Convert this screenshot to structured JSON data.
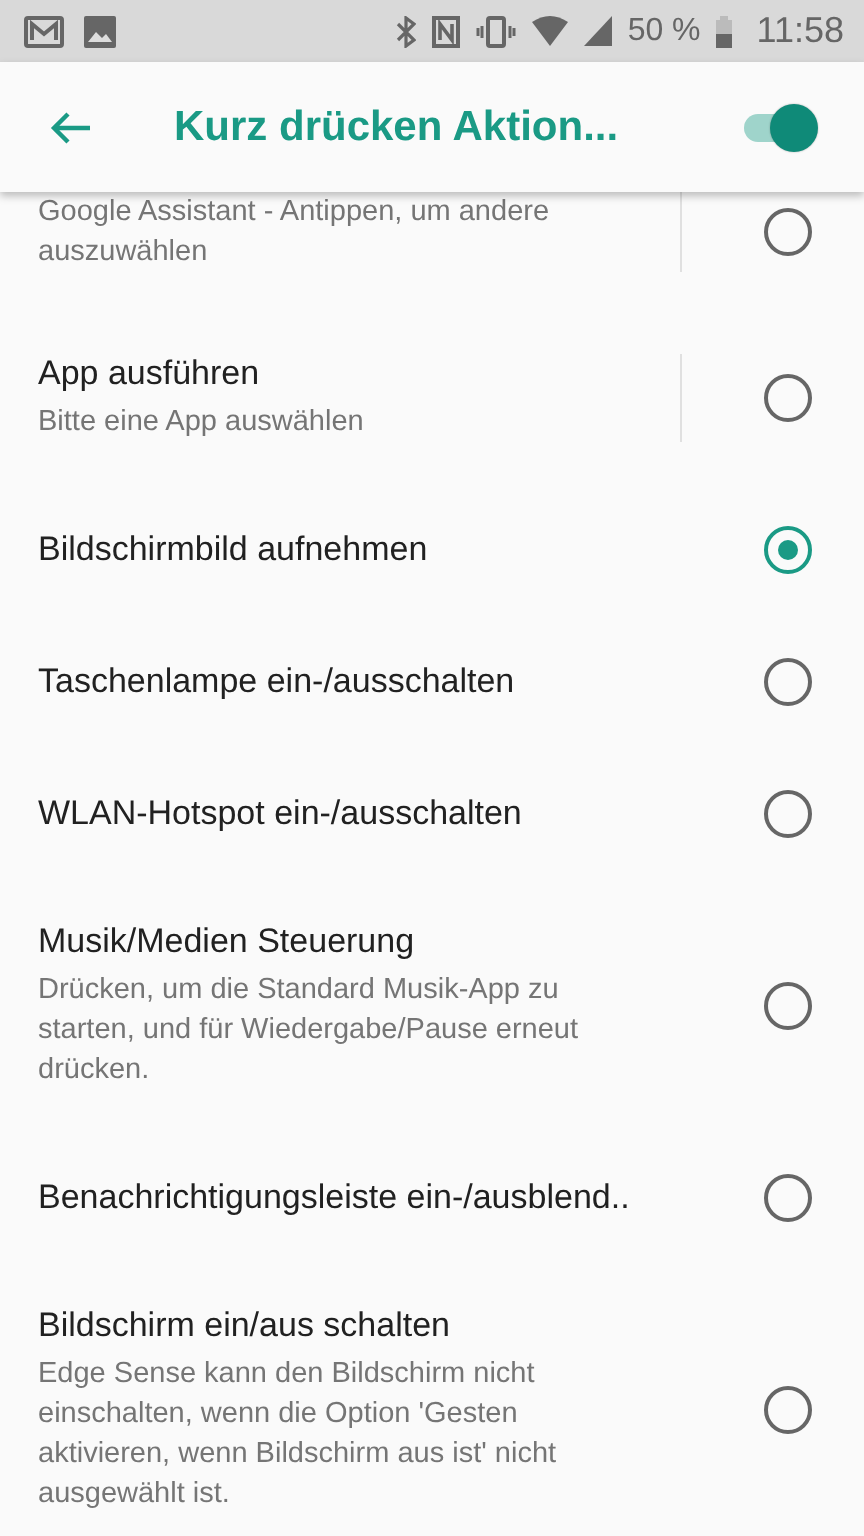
{
  "status_bar": {
    "battery": "50 %",
    "time": "11:58"
  },
  "toolbar": {
    "title": "Kurz drücken Aktion...",
    "switch_on": true
  },
  "options": [
    {
      "subtitle": "Google Assistant - Antippen, um andere auszuwählen",
      "selected": false,
      "settings_divider": true
    },
    {
      "title": "App ausführen",
      "subtitle": "Bitte eine App auswählen",
      "selected": false,
      "settings_divider": true
    },
    {
      "title": "Bildschirmbild aufnehmen",
      "selected": true,
      "settings_divider": false
    },
    {
      "title": "Taschenlampe ein-/ausschalten",
      "selected": false,
      "settings_divider": false
    },
    {
      "title": "WLAN-Hotspot ein-/ausschalten",
      "selected": false,
      "settings_divider": false
    },
    {
      "title": "Musik/Medien Steuerung",
      "subtitle": "Drücken, um die Standard Musik-App zu starten, und für Wiedergabe/Pause erneut drücken.",
      "selected": false,
      "settings_divider": false
    },
    {
      "title": "Benachrichtigungsleiste ein-/ausblend..",
      "selected": false,
      "settings_divider": false
    },
    {
      "title": "Bildschirm ein/aus schalten",
      "subtitle": "Edge Sense kann den Bildschirm nicht einschalten, wenn die Option 'Gesten aktivieren, wenn Bildschirm aus ist' nicht ausgewählt ist.",
      "selected": false,
      "settings_divider": false
    }
  ]
}
